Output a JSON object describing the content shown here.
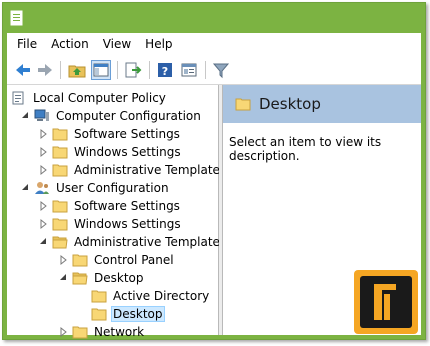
{
  "menu": {
    "file": "File",
    "action": "Action",
    "view": "View",
    "help": "Help"
  },
  "tree": {
    "root": "Local Computer Policy",
    "computer_configuration": "Computer Configuration",
    "cc_software_settings": "Software Settings",
    "cc_windows_settings": "Windows Settings",
    "cc_administrative_templates": "Administrative Templates",
    "user_configuration": "User Configuration",
    "uc_software_settings": "Software Settings",
    "uc_windows_settings": "Windows Settings",
    "uc_administrative_templates": "Administrative Templates",
    "control_panel": "Control Panel",
    "desktop": "Desktop",
    "active_directory": "Active Directory",
    "desktop_child": "Desktop",
    "network": "Network"
  },
  "right_pane": {
    "header_title": "Desktop",
    "description": "Select an item to view its description."
  },
  "colors": {
    "titlebar": "#7cb342",
    "header": "#a9c3e0",
    "selection": "#cce8ff",
    "logo_bg": "#f5a623"
  },
  "icons": [
    "app-icon",
    "back-icon",
    "forward-icon",
    "up-folder-icon",
    "show-hide-tree-icon",
    "export-list-icon",
    "help-icon",
    "properties-icon",
    "filter-icon",
    "folder-icon",
    "computer-icon",
    "user-icon",
    "policy-icon",
    "watermark-logo"
  ]
}
